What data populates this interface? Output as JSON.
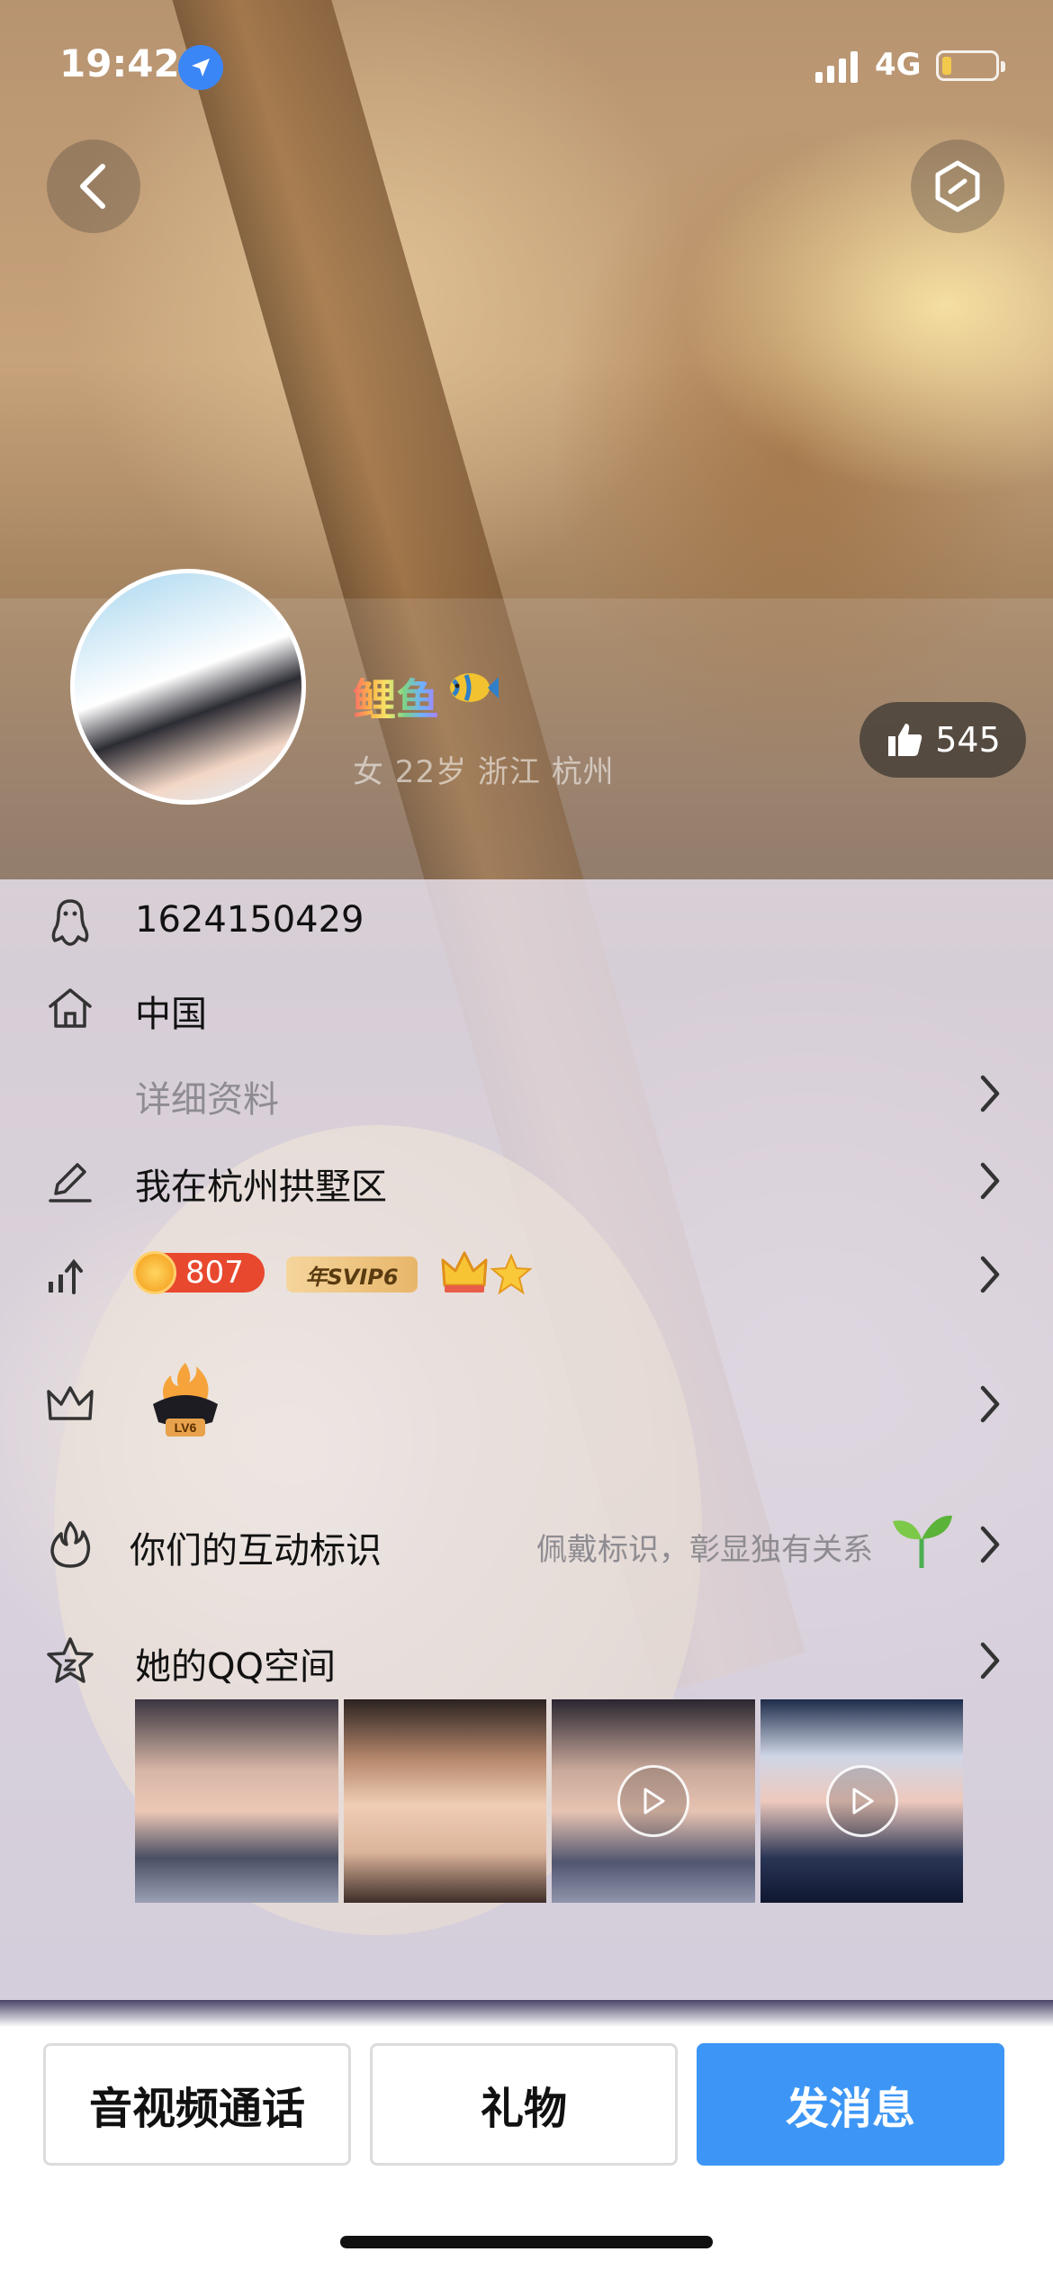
{
  "status_bar": {
    "time": "19:42",
    "network": "4G"
  },
  "profile": {
    "nickname": "鲤鱼",
    "info": "女  22岁  浙江 杭州",
    "likes": "545"
  },
  "rows": {
    "qq_number": "1624150429",
    "country": "中国",
    "details_label": "详细资料",
    "signature": "我在杭州拱墅区",
    "coin_value": "807",
    "svip_label": "年SVIP6",
    "level_label": "LV6",
    "interaction_label": "你们的互动标识",
    "interaction_hint": "佩戴标识，彰显独有关系",
    "qzone_label": "她的QQ空间"
  },
  "actions": {
    "call": "音视频通话",
    "gift": "礼物",
    "message": "发消息"
  },
  "colors": {
    "primary": "#3d96f5",
    "coin": "#e8482e"
  }
}
